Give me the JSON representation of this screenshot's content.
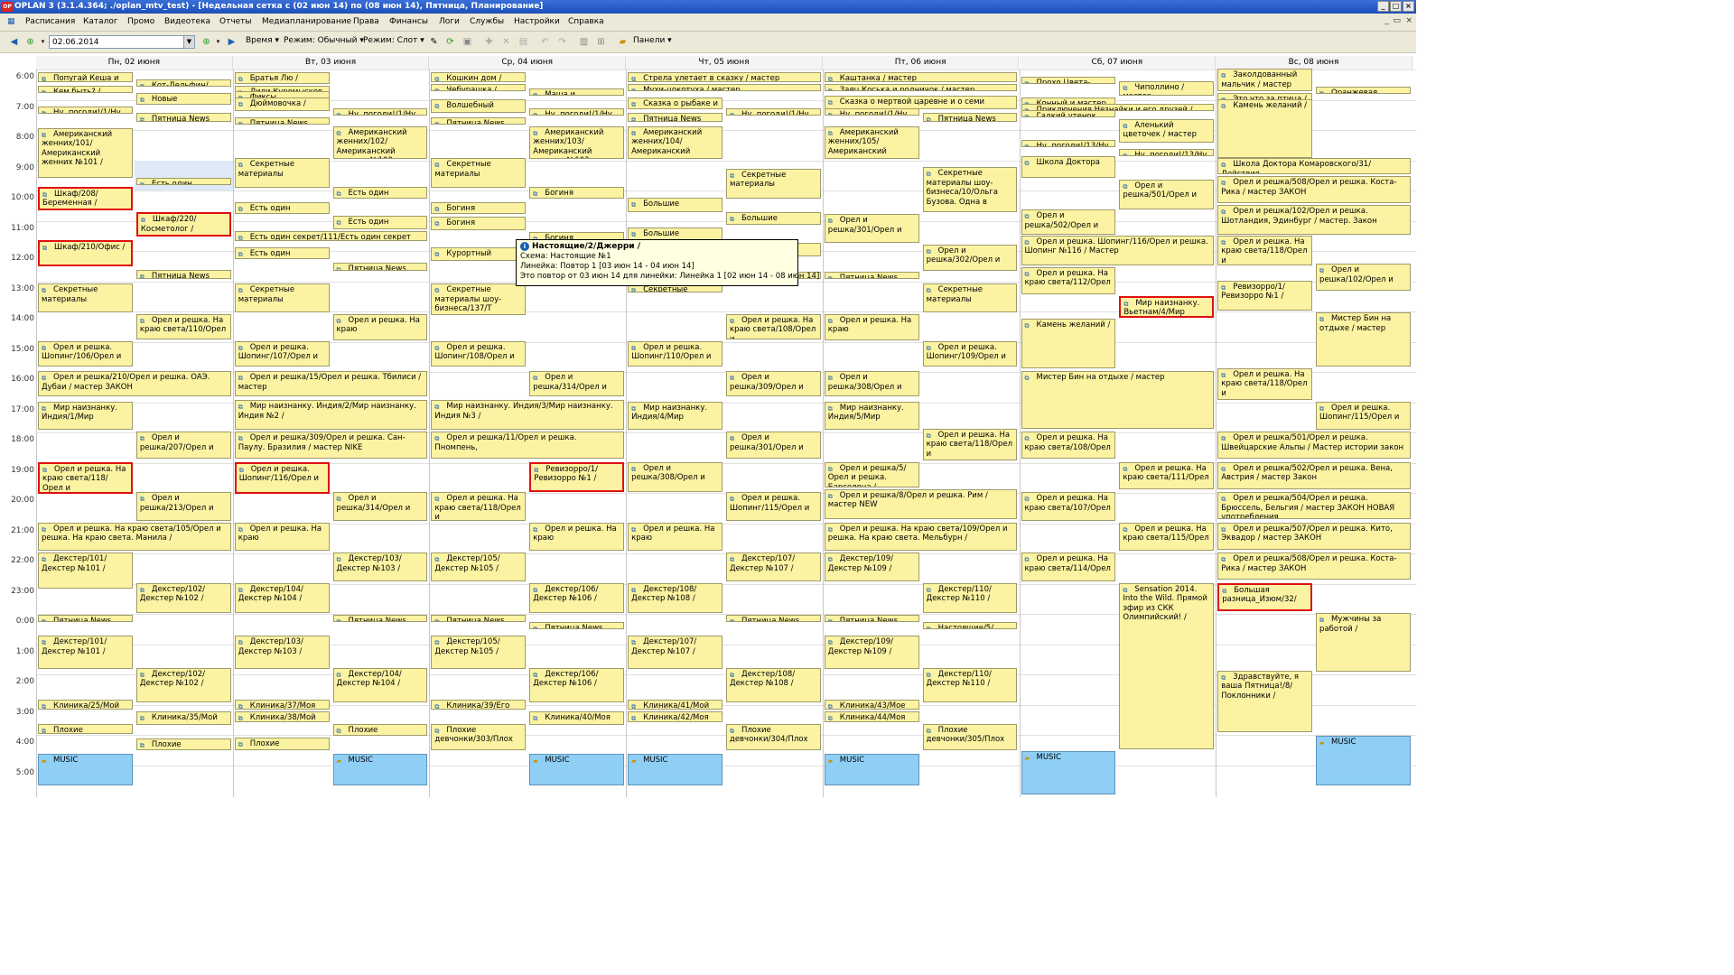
{
  "window": {
    "title": "OPLAN 3  (3.1.4.364; ./oplan_mtv_test) - [Недельная сетка с (02 июн 14) по (08 июн 14), Пятница, Планирование]",
    "logo_text": "OP"
  },
  "menu": {
    "items": [
      "Расписания",
      "Каталог",
      "Промо",
      "Видеотека",
      "Отчеты",
      "Медиапланирование",
      "Права",
      "Финансы",
      "Логи",
      "Службы",
      "Настройки",
      "Справка"
    ]
  },
  "toolbar": {
    "date_value": "02.06.2014",
    "time_label": "Время",
    "mode1_label": "Режим: Обычный",
    "mode2_label": "Режим: Слот",
    "panels_label": "Панели"
  },
  "days": [
    "Пн, 02 июня",
    "Вт, 03 июня",
    "Ср, 04 июня",
    "Чт, 05 июня",
    "Пт, 06 июня",
    "Сб, 07 июня",
    "Вс, 08 июня"
  ],
  "hours": [
    "6:00",
    "7:00",
    "8:00",
    "9:00",
    "10:00",
    "11:00",
    "12:00",
    "13:00",
    "14:00",
    "15:00",
    "16:00",
    "17:00",
    "18:00",
    "19:00",
    "20:00",
    "21:00",
    "22:00",
    "23:00",
    "0:00",
    "1:00",
    "2:00",
    "3:00",
    "4:00",
    "5:00"
  ],
  "tooltip": {
    "title": "Настоящие/2/Джерри /",
    "line1": "Схема: Настоящие №1",
    "line2": "Линейка: Повтор 1 [03 июн 14 - 04 июн 14]",
    "line3": "Это повтор от 03 июн 14 для линейки: Линейка 1 [02 июн 14 - 08 июн 14]"
  },
  "blocks": [
    [
      "Попугай Кеша и",
      0,
      6.05,
      6.45,
      0
    ],
    [
      "Кот-Дельфин/Люби",
      1,
      6.3,
      6.55,
      0
    ],
    [
      "Кем быть? / мастер",
      0,
      6.5,
      6.75,
      0
    ],
    [
      "Новые",
      1,
      6.75,
      7.2,
      0
    ],
    [
      "Ну, погоди!/1/Ну,",
      0,
      7.2,
      7.45,
      0
    ],
    [
      "Пятница News",
      1,
      7.4,
      7.75,
      0
    ],
    [
      "Американский женних/101/Американский женних №101 /",
      0,
      7.9,
      9.6,
      0
    ],
    [
      "Есть один",
      1,
      9.55,
      9.8,
      0
    ],
    [
      "Шкаф/208/Беременная /",
      0,
      9.85,
      10.7,
      1
    ],
    [
      "Шкаф/220/Косметолог /",
      1,
      10.7,
      11.55,
      1
    ],
    [
      "Шкаф/210/Офис /",
      0,
      11.6,
      12.55,
      1
    ],
    [
      "Пятница News",
      1,
      12.6,
      12.95,
      0
    ],
    [
      "Секретные материалы",
      0,
      13.05,
      14.05,
      0
    ],
    [
      "Орел и решка. На краю света/110/Орел",
      1,
      14.05,
      14.95,
      0
    ],
    [
      "Орел и решка. Шопинг/106/Орел и",
      0,
      14.95,
      15.85,
      0
    ],
    [
      "Орел и решка/210/Орел и решка. ОАЭ. Дубаи / мастер ЗАКОН",
      0,
      15.95,
      16.85,
      2
    ],
    [
      "Мир наизнанку. Индия/1/Мир",
      0,
      16.95,
      17.95,
      0
    ],
    [
      "Орел и решка/207/Орел и",
      1,
      17.95,
      18.9,
      0
    ],
    [
      "Орел и решка. На краю света/118/Орел и",
      0,
      18.95,
      20.05,
      1
    ],
    [
      "Орел и решка/213/Орел и",
      1,
      19.95,
      20.95,
      0
    ],
    [
      "Орел и решка. На краю света/105/Орел и решка. На краю света. Манила /",
      0,
      20.95,
      21.95,
      2
    ],
    [
      "Декстер/101/Декстер №101 /",
      0,
      21.95,
      23.2,
      0
    ],
    [
      "Декстер/102/Декстер №102 /",
      1,
      22.95,
      24.0,
      0
    ],
    [
      "Пятница News",
      0,
      24.0,
      24.3,
      0
    ],
    [
      "Декстер/101/Декстер №101 /",
      0,
      24.7,
      25.85,
      0
    ],
    [
      "Декстер/102/Декстер №102 /",
      1,
      25.75,
      26.95,
      0
    ],
    [
      "Клиника/25/Мой",
      0,
      26.8,
      27.2,
      0
    ],
    [
      "Клиника/35/Мой",
      1,
      27.2,
      27.7,
      0
    ],
    [
      "Плохие",
      0,
      27.6,
      28.0,
      0
    ],
    [
      "Плохие",
      1,
      28.1,
      28.55,
      0
    ],
    [
      "MUSIC",
      0,
      28.6,
      29.7,
      3
    ],
    [
      "Братья Лю /",
      2,
      6.05,
      6.5,
      0
    ],
    [
      "Лили Куромысков / мастер",
      2,
      6.5,
      6.75,
      0
    ],
    [
      "Фиксы Кулабасова / мастер",
      2,
      6.7,
      6.9,
      0
    ],
    [
      "Дюймовочка /",
      2,
      6.9,
      7.4,
      0
    ],
    [
      "Ну, погоди!/1/Ну",
      3,
      7.25,
      7.5,
      0
    ],
    [
      "Пятница News",
      2,
      7.55,
      7.85,
      0
    ],
    [
      "Американский женних/102/Американский женних №102",
      3,
      7.85,
      9.0,
      0
    ],
    [
      "Секретные материалы",
      2,
      8.9,
      9.95,
      0
    ],
    [
      "Есть один",
      3,
      9.85,
      10.3,
      0
    ],
    [
      "Есть один",
      2,
      10.35,
      10.8,
      0
    ],
    [
      "Есть один",
      3,
      10.8,
      11.3,
      0
    ],
    [
      "Есть один секрет/111/Есть один секрет",
      2,
      11.3,
      11.7,
      2
    ],
    [
      "Есть один",
      2,
      11.85,
      12.3,
      0
    ],
    [
      "Пятница News",
      3,
      12.35,
      12.7,
      0
    ],
    [
      "Секретные материалы",
      2,
      13.05,
      14.05,
      0
    ],
    [
      "Орел и решка. На краю",
      3,
      14.05,
      15.0,
      0
    ],
    [
      "Орел и решка. Шопинг/107/Орел и",
      2,
      14.95,
      15.85,
      0
    ],
    [
      "Орел и решка/15/Орел и решка. Тбилиси / мастер",
      2,
      15.95,
      16.85,
      2
    ],
    [
      "Мир наизнанку. Индия/2/Мир наизнанку. Индия №2 /",
      2,
      16.9,
      17.95,
      2
    ],
    [
      "Орел и решка/309/Орел и решка. Сан-Паулу. Бразилия / мастер NIKE",
      2,
      17.95,
      18.9,
      2
    ],
    [
      "Орел и решка. Шопинг/116/Орел и",
      2,
      18.95,
      20.05,
      1
    ],
    [
      "Орел и решка/314/Орел и",
      3,
      19.95,
      20.95,
      0
    ],
    [
      "Орел и решка. На краю",
      2,
      20.95,
      21.95,
      0
    ],
    [
      "Декстер/103/Декстер №103 /",
      3,
      21.95,
      22.95,
      0
    ],
    [
      "Декстер/104/Декстер №104 /",
      2,
      22.95,
      24.0,
      0
    ],
    [
      "Пятница News",
      3,
      24.0,
      24.3,
      0
    ],
    [
      "Декстер/103/Декстер №103 /",
      2,
      24.7,
      25.85,
      0
    ],
    [
      "Декстер/104/Декстер №104 /",
      3,
      25.75,
      26.95,
      0
    ],
    [
      "Клиника/37/Моя",
      2,
      26.8,
      27.2,
      0
    ],
    [
      "Клиника/38/Мой",
      2,
      27.2,
      27.6,
      0
    ],
    [
      "Плохие",
      3,
      27.6,
      28.05,
      0
    ],
    [
      "Плохие",
      2,
      28.05,
      28.55,
      0
    ],
    [
      "MUSIC",
      3,
      28.6,
      29.7,
      3
    ],
    [
      "Кошкин дом /",
      4,
      6.05,
      6.45,
      0
    ],
    [
      "Чебурашка / мастер",
      4,
      6.45,
      6.75,
      0
    ],
    [
      "Маша и волшебное",
      5,
      6.6,
      6.85,
      0
    ],
    [
      "Волшебный",
      4,
      6.95,
      7.45,
      0
    ],
    [
      "Ну, погоди!/1/Ну",
      5,
      7.25,
      7.5,
      0
    ],
    [
      "Пятница News",
      4,
      7.55,
      7.85,
      0
    ],
    [
      "Американский женних/103/Американский женних №103",
      5,
      7.85,
      9.0,
      0
    ],
    [
      "Секретные материалы",
      4,
      8.9,
      9.95,
      0
    ],
    [
      "Богиня",
      5,
      9.85,
      10.3,
      0
    ],
    [
      "Богиня",
      4,
      10.35,
      10.8,
      0
    ],
    [
      "Богиня",
      4,
      10.85,
      11.35,
      0
    ],
    [
      "Богиня",
      5,
      11.35,
      11.8,
      0
    ],
    [
      "Курортный",
      4,
      11.85,
      12.35,
      0
    ],
    [
      "Пятница News",
      5,
      12.35,
      12.7,
      0
    ],
    [
      "Секретные материалы шоу-бизнеса/137/Т",
      4,
      13.05,
      14.15,
      0
    ],
    [
      "Орел и решка. Шопинг/108/Орел и",
      4,
      14.95,
      15.85,
      0
    ],
    [
      "Орел и решка/314/Орел и",
      5,
      15.95,
      16.85,
      0
    ],
    [
      "Мир наизнанку. Индия/3/Мир наизнанку. Индия №3 /",
      4,
      16.9,
      17.95,
      2
    ],
    [
      "Орел и решка/11/Орел и решка. Пномпень,",
      4,
      17.95,
      18.9,
      2
    ],
    [
      "Ревизорро/1/Ревизорро №1 /",
      5,
      18.95,
      20.0,
      1
    ],
    [
      "Орел и решка. На краю света/118/Орел и",
      4,
      19.95,
      20.95,
      0
    ],
    [
      "Орел и решка. На краю",
      5,
      20.95,
      21.95,
      0
    ],
    [
      "Декстер/105/Декстер №105 /",
      4,
      21.95,
      22.95,
      0
    ],
    [
      "Декстер/106/Декстер №106 /",
      5,
      22.95,
      24.0,
      0
    ],
    [
      "Пятница News",
      4,
      24.0,
      24.3,
      0
    ],
    [
      "Пятница News",
      5,
      24.25,
      24.45,
      0
    ],
    [
      "Декстер/105/Декстер №105 /",
      4,
      24.7,
      25.85,
      0
    ],
    [
      "Декстер/106/Декстер №106 /",
      5,
      25.75,
      26.95,
      0
    ],
    [
      "Клиника/39/Его",
      4,
      26.8,
      27.2,
      0
    ],
    [
      "Клиника/40/Моя",
      5,
      27.2,
      27.7,
      0
    ],
    [
      "Плохие девчонки/303/Плох",
      4,
      27.6,
      28.55,
      0
    ],
    [
      "MUSIC",
      5,
      28.6,
      29.7,
      3
    ],
    [
      "Стрела улетает в сказку / мастер",
      6,
      6.05,
      6.45,
      2
    ],
    [
      "Мухи-цокотуха / мастер",
      6,
      6.45,
      6.75,
      2
    ],
    [
      "Сказка о рыбаке и",
      6,
      6.9,
      7.35,
      0
    ],
    [
      "Пятница News",
      6,
      7.4,
      7.75,
      0
    ],
    [
      "Ну, погоди!/1/Ну",
      7,
      7.25,
      7.5,
      0
    ],
    [
      "Американский женних/104/Американский женних",
      6,
      7.85,
      9.0,
      0
    ],
    [
      "Секретные материалы",
      7,
      9.25,
      10.3,
      0
    ],
    [
      "Большие",
      6,
      10.2,
      10.75,
      0
    ],
    [
      "Большие",
      7,
      10.7,
      11.15,
      0
    ],
    [
      "Большие",
      6,
      11.2,
      11.7,
      0
    ],
    [
      "Большие",
      7,
      11.7,
      12.2,
      0
    ],
    [
      "Большие",
      6,
      12.2,
      12.7,
      0
    ],
    [
      "Пятница News",
      7,
      12.65,
      12.95,
      0
    ],
    [
      "Секретные",
      6,
      13.05,
      13.4,
      0
    ],
    [
      "Орел и решка. На краю света/108/Орел и",
      7,
      14.05,
      14.95,
      0
    ],
    [
      "Орел и решка. Шопинг/110/Орел и",
      6,
      14.95,
      15.85,
      0
    ],
    [
      "Орел и решка/309/Орел и",
      7,
      15.95,
      16.85,
      0
    ],
    [
      "Мир наизнанку. Индия/4/Мир",
      6,
      16.95,
      17.95,
      0
    ],
    [
      "Орел и решка/301/Орел и",
      7,
      17.95,
      18.9,
      0
    ],
    [
      "Орел и решка/308/Орел и",
      6,
      18.95,
      20.0,
      0
    ],
    [
      "Орел и решка. Шопинг/115/Орел и",
      7,
      19.95,
      20.95,
      0
    ],
    [
      "Орел и решка. На краю",
      6,
      20.95,
      21.95,
      0
    ],
    [
      "Декстер/107/Декстер №107 /",
      7,
      21.95,
      22.95,
      0
    ],
    [
      "Декстер/108/Декстер №108 /",
      6,
      22.95,
      24.0,
      0
    ],
    [
      "Пятница News",
      7,
      24.0,
      24.3,
      0
    ],
    [
      "Декстер/107/Декстер №107 /",
      6,
      24.7,
      25.85,
      0
    ],
    [
      "Декстер/108/Декстер №108 /",
      7,
      25.75,
      26.95,
      0
    ],
    [
      "Клиника/41/Мой",
      6,
      26.8,
      27.2,
      0
    ],
    [
      "Клиника/42/Моя",
      6,
      27.2,
      27.6,
      0
    ],
    [
      "Плохие девчонки/304/Плох",
      7,
      27.6,
      28.55,
      0
    ],
    [
      "MUSIC",
      6,
      28.6,
      29.7,
      3
    ],
    [
      "Каштанка / мастер",
      8,
      6.05,
      6.45,
      2
    ],
    [
      "Заяц Коська и родничок / мастер",
      8,
      6.45,
      6.75,
      2
    ],
    [
      "Сказка о мертвой царевне и о семи",
      8,
      6.85,
      7.35,
      2
    ],
    [
      "Ну, погоди!/1/Ну",
      8,
      7.25,
      7.5,
      0
    ],
    [
      "Пятница News",
      9,
      7.4,
      7.75,
      0
    ],
    [
      "Американский женних/105/Американский женних",
      8,
      7.85,
      9.0,
      0
    ],
    [
      "Секретные материалы шоу-бизнеса/10/Ольга Бузова. Одна в",
      9,
      9.2,
      10.75,
      0
    ],
    [
      "Орел и решка/301/Орел и",
      8,
      10.75,
      11.75,
      0
    ],
    [
      "Орел и решка/302/Орел и",
      9,
      11.75,
      12.7,
      0
    ],
    [
      "Пятница News",
      8,
      12.65,
      12.95,
      0
    ],
    [
      "Секретные материалы",
      9,
      13.05,
      14.05,
      0
    ],
    [
      "Орел и решка. На краю",
      8,
      14.05,
      15.0,
      0
    ],
    [
      "Орел и решка. Шопинг/109/Орел и",
      9,
      14.95,
      15.85,
      0
    ],
    [
      "Орел и решка/308/Орел и",
      8,
      15.95,
      16.85,
      0
    ],
    [
      "Мир наизнанку. Индия/5/Мир",
      8,
      16.95,
      17.95,
      0
    ],
    [
      "Орел и решка. На краю света/118/Орел и",
      9,
      17.85,
      18.95,
      0
    ],
    [
      "Орел и решка/5/Орел и решка. Барселона /",
      8,
      18.95,
      19.85,
      0
    ],
    [
      "Орел и решка/8/Орел и решка. Рим / мастер NEW",
      8,
      19.85,
      20.9,
      2
    ],
    [
      "Орел и решка. На краю света/109/Орел и решка. На краю света. Мельбурн /",
      8,
      20.95,
      21.95,
      2
    ],
    [
      "Декстер/109/Декстер №109 /",
      8,
      21.95,
      22.95,
      0
    ],
    [
      "Декстер/110/Декстер №110 /",
      9,
      22.95,
      24.0,
      0
    ],
    [
      "Пятница News",
      8,
      24.0,
      24.3,
      0
    ],
    [
      "Настоящие/5/Чипп",
      9,
      24.25,
      24.5,
      0
    ],
    [
      "Декстер/109/Декстер №109 /",
      8,
      24.7,
      25.85,
      0
    ],
    [
      "Декстер/110/Декстер №110 /",
      9,
      25.75,
      26.95,
      0
    ],
    [
      "Клиника/43/Мое",
      8,
      26.8,
      27.2,
      0
    ],
    [
      "Клиника/44/Моя",
      8,
      27.2,
      27.6,
      0
    ],
    [
      "Плохие девчонки/305/Плох",
      9,
      27.6,
      28.55,
      0
    ],
    [
      "MUSIC",
      8,
      28.6,
      29.7,
      3
    ],
    [
      "Прохо Цвета-радуге",
      10,
      6.2,
      6.4,
      0
    ],
    [
      "Чиполлино / мастер",
      11,
      6.35,
      6.9,
      0
    ],
    [
      "Конный и мастер",
      10,
      6.9,
      7.15,
      0
    ],
    [
      "Приключения Незнайки и его друзей / мастер",
      10,
      7.1,
      7.3,
      2
    ],
    [
      "Гадкий утенок",
      10,
      7.3,
      7.5,
      0
    ],
    [
      "Аленький цветочек / мастер",
      11,
      7.6,
      8.45,
      0
    ],
    [
      "Ну, погоди!/13/Ну",
      10,
      8.3,
      8.55,
      0
    ],
    [
      "Ну, погоди!/13/Ну",
      11,
      8.6,
      8.85,
      0
    ],
    [
      "Школа Доктора",
      10,
      8.85,
      9.6,
      0
    ],
    [
      "Орел и решка/501/Орел и",
      11,
      9.6,
      10.65,
      0
    ],
    [
      "Орел и решка/502/Орел и",
      10,
      10.6,
      11.5,
      0
    ],
    [
      "Орел и решка. Шопинг/116/Орел и решка. Шопинг №116 / Мастер",
      10,
      11.45,
      12.5,
      2
    ],
    [
      "Орел и решка. На краю света/112/Орел",
      10,
      12.5,
      13.45,
      0
    ],
    [
      "Мир наизнанку. Вьетнам/4/Мир",
      11,
      13.45,
      14.25,
      1
    ],
    [
      "Камень желаний /",
      10,
      14.2,
      15.9,
      0
    ],
    [
      "Мистер Бин на отдыхе / мастер",
      10,
      15.95,
      17.9,
      2
    ],
    [
      "Орел и решка. На краю света/108/Орел",
      10,
      17.95,
      18.9,
      0
    ],
    [
      "Орел и решка. На краю света/111/Орел",
      11,
      18.95,
      19.9,
      0
    ],
    [
      "Орел и решка. На краю света/107/Орел",
      10,
      19.95,
      20.95,
      0
    ],
    [
      "Орел и решка. На краю света/115/Орел",
      11,
      20.95,
      21.95,
      0
    ],
    [
      "Орел и решка. На краю света/114/Орел",
      10,
      21.95,
      22.95,
      0
    ],
    [
      "Sensation 2014. Into the Wild. Прямой эфир из СКК Олимпийский! /",
      11,
      22.95,
      28.5,
      0
    ],
    [
      "MUSIC",
      10,
      28.5,
      30.0,
      3
    ],
    [
      "Заколдованный мальчик / мастер",
      12,
      5.95,
      6.75,
      0
    ],
    [
      "Оранжевая корова",
      13,
      6.55,
      6.75,
      0
    ],
    [
      "Это что за птица / мастер",
      12,
      6.75,
      6.95,
      0
    ],
    [
      "Камень желаний /",
      12,
      6.95,
      8.95,
      0
    ],
    [
      "Школа Доктора Комаровского/31/Действия",
      12,
      8.9,
      9.5,
      2
    ],
    [
      "Орел и решка/508/Орел и решка. Коста-Рика / мастер ЗАКОН",
      12,
      9.5,
      10.45,
      2
    ],
    [
      "Орел и решка/102/Орел и решка. Шотландия, Эдинбург / мастер. Закон",
      12,
      10.45,
      11.5,
      2
    ],
    [
      "Орел и решка. На краю света/118/Орел и",
      12,
      11.45,
      12.5,
      0
    ],
    [
      "Орел и решка/102/Орел и",
      13,
      12.4,
      13.35,
      0
    ],
    [
      "Ревизорро/1/Ревизорро №1 /",
      12,
      12.95,
      14.0,
      0
    ],
    [
      "Мистер Бин на отдыхе / мастер",
      13,
      14.0,
      15.85,
      0
    ],
    [
      "Орел и решка. На краю света/118/Орел и",
      12,
      15.85,
      16.95,
      0
    ],
    [
      "Орел и решка. Шопинг/115/Орел и",
      13,
      16.95,
      17.95,
      0
    ],
    [
      "Орел и решка/501/Орел и решка. Швейцарские Альпы / Мастер истории закон",
      12,
      17.95,
      18.9,
      2
    ],
    [
      "Орел и решка/502/Орел и решка. Вена, Австрия / мастер Закон",
      12,
      18.95,
      19.9,
      2
    ],
    [
      "Орел и решка/504/Орел и решка. Брюссель, Бельгия / мастер ЗАКОН НОВАЯ употребления",
      12,
      19.95,
      20.9,
      2
    ],
    [
      "Орел и решка/507/Орел и решка. Кито, Эквадор / мастер ЗАКОН",
      12,
      20.95,
      21.9,
      2
    ],
    [
      "Орел и решка/508/Орел и решка. Коста-Рика / мастер ЗАКОН",
      12,
      21.95,
      22.9,
      2
    ],
    [
      "Большая разница_Изюм/32/",
      12,
      22.95,
      23.95,
      1
    ],
    [
      "Мужчины за работой /",
      13,
      23.95,
      25.95,
      0
    ],
    [
      "Здравствуйте, я ваша Пятница!/8/Поклонники /",
      12,
      25.85,
      27.95,
      0
    ],
    [
      "MUSIC",
      13,
      28.0,
      29.7,
      3
    ]
  ]
}
